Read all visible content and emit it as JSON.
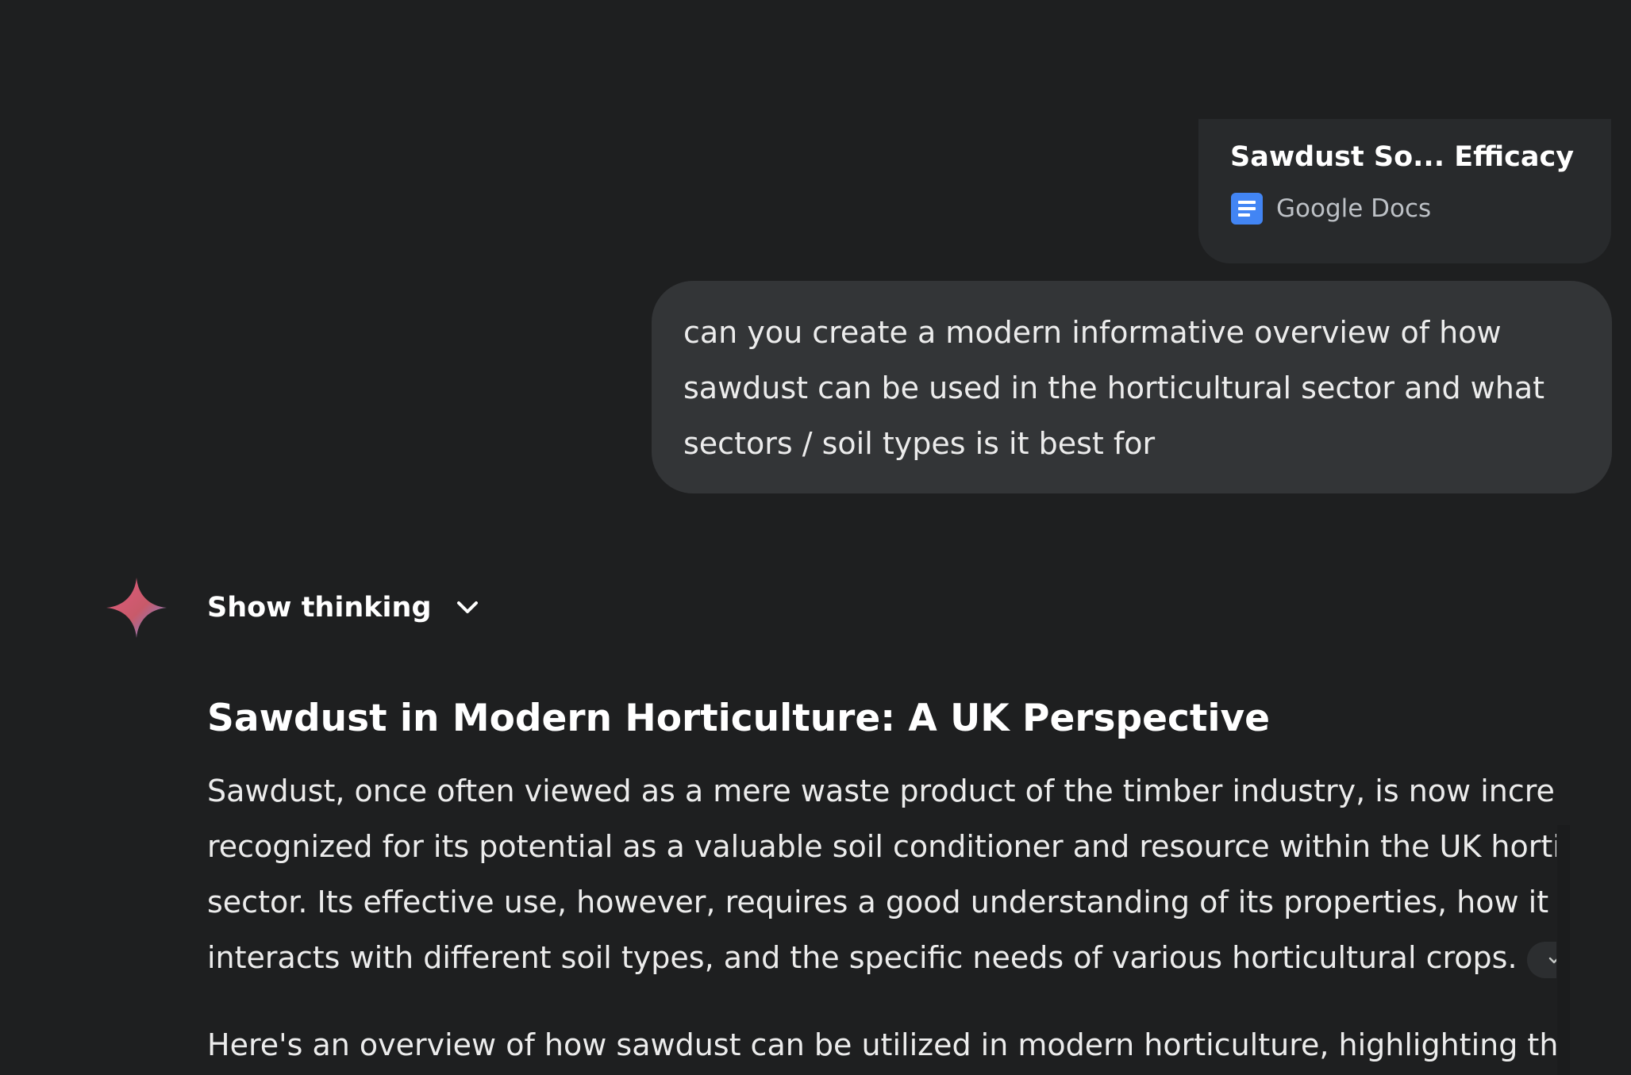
{
  "attachment": {
    "title": "Sawdust So... Efficacy",
    "source": "Google Docs"
  },
  "user_prompt": {
    "lines": [
      "can you create a modern informative overview of how",
      "sawdust can be used in the horticultural sector and what",
      "sectors / soil types is it best for"
    ]
  },
  "response": {
    "thinking_label": "Show thinking",
    "heading": "Sawdust in Modern Horticulture: A UK Perspective",
    "paragraph1_lines": [
      "Sawdust, once often viewed as a mere waste product of the timber industry, is now increasing",
      "recognized for its potential as a valuable soil conditioner and resource within the UK horticultu",
      "sector. Its effective use, however, requires a good understanding of its properties, how it",
      "interacts with different soil types, and the specific needs of various horticultural crops."
    ],
    "paragraph2_line": "Here's an overview of how sawdust can be utilized in modern horticulture, highlighting the"
  },
  "icons": {
    "docs": "google-docs-icon",
    "gemini": "gemini-sparkle-icon",
    "chevron": "chevron-down-icon"
  },
  "colors": {
    "background": "#1e1f20",
    "bubble": "#333537",
    "docs_blue": "#4285f4"
  }
}
